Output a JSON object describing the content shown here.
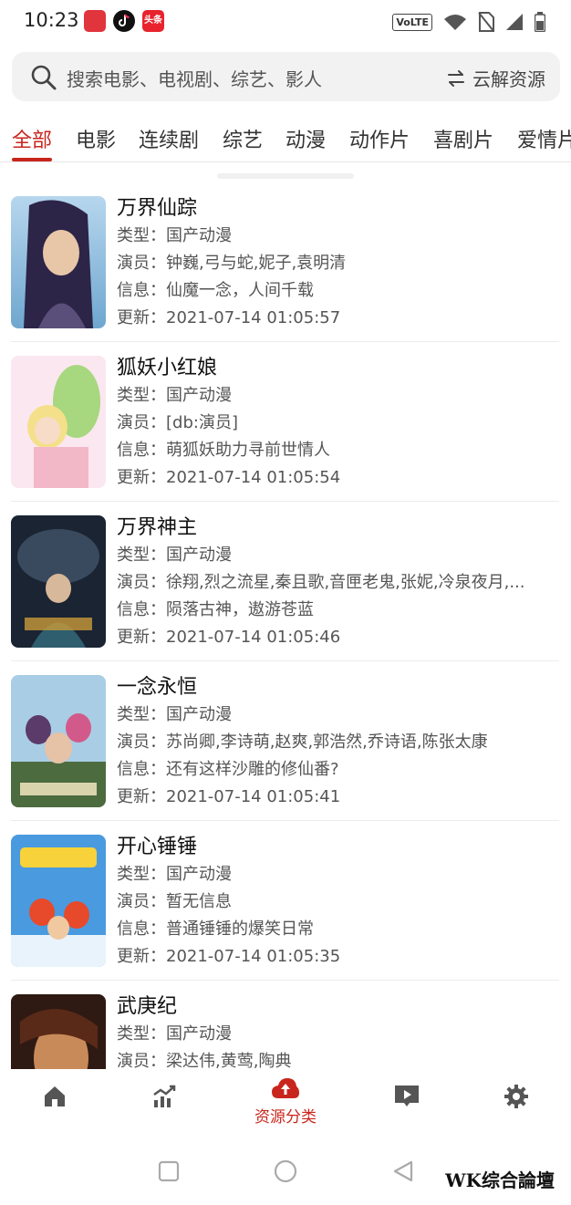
{
  "status_bar": {
    "time": "10:23",
    "app3_label": "头条",
    "network": "VoLTE"
  },
  "search": {
    "placeholder": "搜索电影、电视剧、综艺、影人",
    "cloud_label": "云解资源"
  },
  "tabs": [
    {
      "label": "全部",
      "active": true
    },
    {
      "label": "电影"
    },
    {
      "label": "连续剧"
    },
    {
      "label": "综艺"
    },
    {
      "label": "动漫"
    },
    {
      "label": "动作片"
    },
    {
      "label": "喜剧片"
    },
    {
      "label": "爱情片"
    }
  ],
  "items": [
    {
      "title": "万界仙踪",
      "type": "类型：国产动漫",
      "cast": "演员：钟巍,弓与蛇,妮子,袁明清",
      "info": "信息：仙魔一念，人间千载",
      "updated": "更新：2021-07-14 01:05:57",
      "poster_colors": [
        "#8fb6d8",
        "#3a2f5c"
      ]
    },
    {
      "title": "狐妖小红娘",
      "type": "类型：国产动漫",
      "cast": "演员：[db:演员]",
      "info": "信息：萌狐妖助力寻前世情人",
      "updated": "更新：2021-07-14 01:05:54",
      "poster_colors": [
        "#f6d7e8",
        "#9fd07a"
      ]
    },
    {
      "title": "万界神主",
      "type": "类型：国产动漫",
      "cast": "演员：徐翔,烈之流星,秦且歌,音匣老鬼,张妮,冷泉夜月,...",
      "info": "信息：陨落古神，遨游苍蓝",
      "updated": "更新：2021-07-14 01:05:46",
      "poster_colors": [
        "#1c2a3a",
        "#c89a3a"
      ]
    },
    {
      "title": "一念永恒",
      "type": "类型：国产动漫",
      "cast": "演员：苏尚卿,李诗萌,赵爽,郭浩然,乔诗语,陈张太康",
      "info": "信息：还有这样沙雕的修仙番?",
      "updated": "更新：2021-07-14 01:05:41",
      "poster_colors": [
        "#7ab0d0",
        "#3d5a3a"
      ]
    },
    {
      "title": "开心锤锤",
      "type": "类型：国产动漫",
      "cast": "演员：暂无信息",
      "info": "信息：普通锤锤的爆笑日常",
      "updated": "更新：2021-07-14 01:05:35",
      "poster_colors": [
        "#3f8fd8",
        "#e64a2a"
      ]
    },
    {
      "title": "武庚纪",
      "type": "类型：国产动漫",
      "cast": "演员：梁达伟,黄莺,陶典",
      "info": "",
      "updated": "",
      "poster_colors": [
        "#3a1e14",
        "#d88a4a"
      ]
    }
  ],
  "bottom_nav": {
    "items": [
      {
        "icon": "home-icon"
      },
      {
        "icon": "trend-icon"
      },
      {
        "icon": "cloud-upload-icon",
        "label": "资源分类",
        "active": true
      },
      {
        "icon": "video-play-icon"
      },
      {
        "icon": "gear-icon"
      }
    ]
  },
  "watermark": "WK综合論壇",
  "colors": {
    "accent": "#c8261d",
    "text": "#222222",
    "muted": "#555555"
  }
}
